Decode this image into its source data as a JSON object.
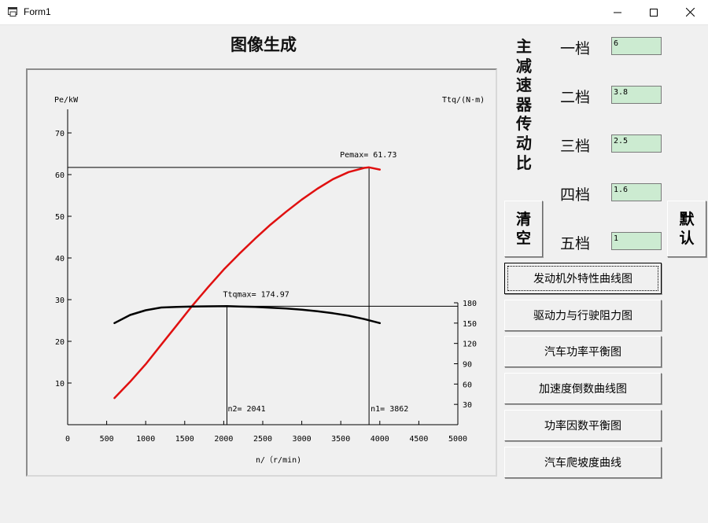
{
  "window": {
    "title": "Form1"
  },
  "page_title": "图像生成",
  "vertical_label": [
    "主",
    "减",
    "速",
    "器",
    "传",
    "动",
    "比"
  ],
  "gears": [
    {
      "label": "一档",
      "value": "6"
    },
    {
      "label": "二档",
      "value": "3.8"
    },
    {
      "label": "三档",
      "value": "2.5"
    },
    {
      "label": "四档",
      "value": "1.6"
    },
    {
      "label": "五档",
      "value": "1"
    }
  ],
  "clear_button": [
    "清",
    "空"
  ],
  "default_button": [
    "默",
    "认"
  ],
  "menu_buttons": [
    "发动机外特性曲线图",
    "驱动力与行驶阻力图",
    "汽车功率平衡图",
    "加速度倒数曲线图",
    "功率因数平衡图",
    "汽车爬坡度曲线"
  ],
  "chart_data": {
    "type": "line",
    "xlabel": "n/（r/min)",
    "ylabel_left": "Pe/kW",
    "ylabel_right": "Ttq/(N·m)",
    "xlim": [
      0,
      5000
    ],
    "ylim_left": [
      0,
      75
    ],
    "ylim_right": [
      0,
      195
    ],
    "x_ticks": [
      "0",
      "500",
      "1000",
      "1500",
      "2000",
      "2500",
      "3000",
      "3500",
      "4000",
      "4500",
      "5000"
    ],
    "y_left_ticks": [
      "10",
      "20",
      "30",
      "40",
      "50",
      "60",
      "70"
    ],
    "y_right_ticks": [
      "30",
      "60",
      "90",
      "120",
      "150",
      "180"
    ],
    "series": [
      {
        "axis": "left",
        "color": "#e01010",
        "points": [
          [
            600,
            6.4
          ],
          [
            800,
            10.3
          ],
          [
            1000,
            14.5
          ],
          [
            1200,
            19.2
          ],
          [
            1400,
            23.9
          ],
          [
            1600,
            28.6
          ],
          [
            1800,
            33.0
          ],
          [
            2000,
            37.2
          ],
          [
            2200,
            41.0
          ],
          [
            2400,
            44.6
          ],
          [
            2600,
            48.0
          ],
          [
            2800,
            51.1
          ],
          [
            3000,
            54.0
          ],
          [
            3200,
            56.6
          ],
          [
            3400,
            58.9
          ],
          [
            3600,
            60.6
          ],
          [
            3800,
            61.6
          ],
          [
            3862,
            61.73
          ],
          [
            4000,
            61.2
          ]
        ]
      },
      {
        "axis": "right",
        "color": "#000000",
        "points": [
          [
            600,
            150
          ],
          [
            800,
            162
          ],
          [
            1000,
            169
          ],
          [
            1200,
            173
          ],
          [
            1400,
            174
          ],
          [
            1600,
            174.5
          ],
          [
            1800,
            174.8
          ],
          [
            2041,
            174.97
          ],
          [
            2200,
            174.5
          ],
          [
            2400,
            173.8
          ],
          [
            2600,
            172.8
          ],
          [
            2800,
            171.5
          ],
          [
            3000,
            169.8
          ],
          [
            3200,
            167.5
          ],
          [
            3400,
            164.6
          ],
          [
            3600,
            161
          ],
          [
            3800,
            156
          ],
          [
            4000,
            150
          ]
        ]
      }
    ],
    "annotations": [
      {
        "text": "Pemax= 61.73",
        "x": 3862,
        "y_left": 61.73
      },
      {
        "text": "Ttqmax= 174.97",
        "x": 2041,
        "y_right": 174.97
      },
      {
        "text": "n2= 2041",
        "x": 2041
      },
      {
        "text": "n1= 3862",
        "x": 3862
      }
    ]
  }
}
